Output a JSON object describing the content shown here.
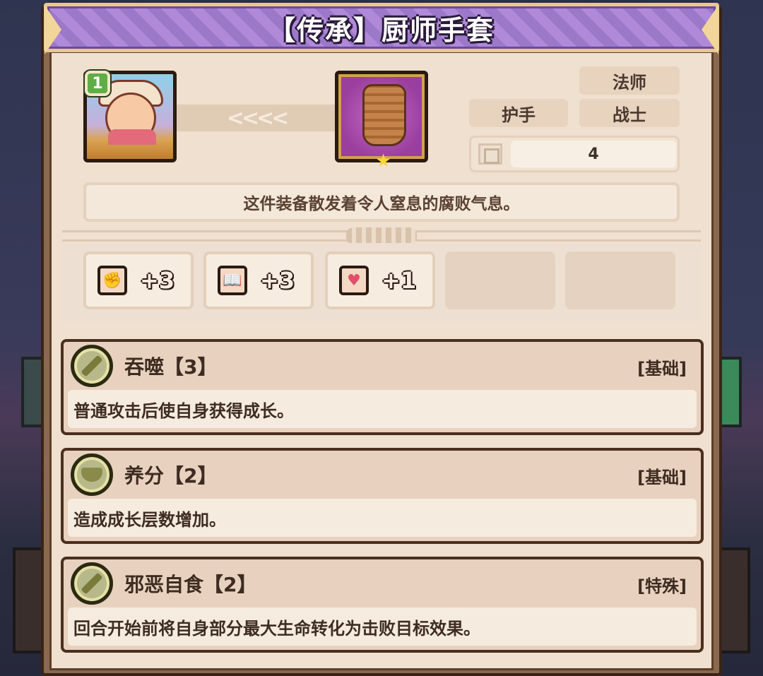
{
  "title": "【传承】厨师手套",
  "hero": {
    "level": "1"
  },
  "transfer_arrows": "<<<<",
  "item": {
    "tags": {
      "class_1": "法师",
      "slot": "护手",
      "class_2": "战士"
    },
    "stack_value": "4",
    "description": "这件装备散发着令人窒息的腐败气息。"
  },
  "stats": [
    {
      "icon": "fist-icon",
      "glyph": "✊",
      "value": "+3"
    },
    {
      "icon": "book-icon",
      "glyph": "📖",
      "value": "+3"
    },
    {
      "icon": "heart-icon",
      "glyph": "♥",
      "value": "+1"
    }
  ],
  "skills": [
    {
      "name": "吞噬【3】",
      "type": "[基础]",
      "desc": "普通攻击后使自身获得成长。",
      "icon": "slash-icon"
    },
    {
      "name": "养分【2】",
      "type": "[基础]",
      "desc": "造成成长层数增加。",
      "icon": "bowl-icon"
    },
    {
      "name": "邪恶自食【2】",
      "type": "[特殊]",
      "desc": "回合开始前将自身部分最大生命转化为击败目标效果。",
      "icon": "slash-icon"
    }
  ],
  "colors": {
    "title_purple": "#9b78c8",
    "panel": "#efe0cf",
    "frame": "#8a6a4e",
    "badge_green": "#5fae45"
  }
}
